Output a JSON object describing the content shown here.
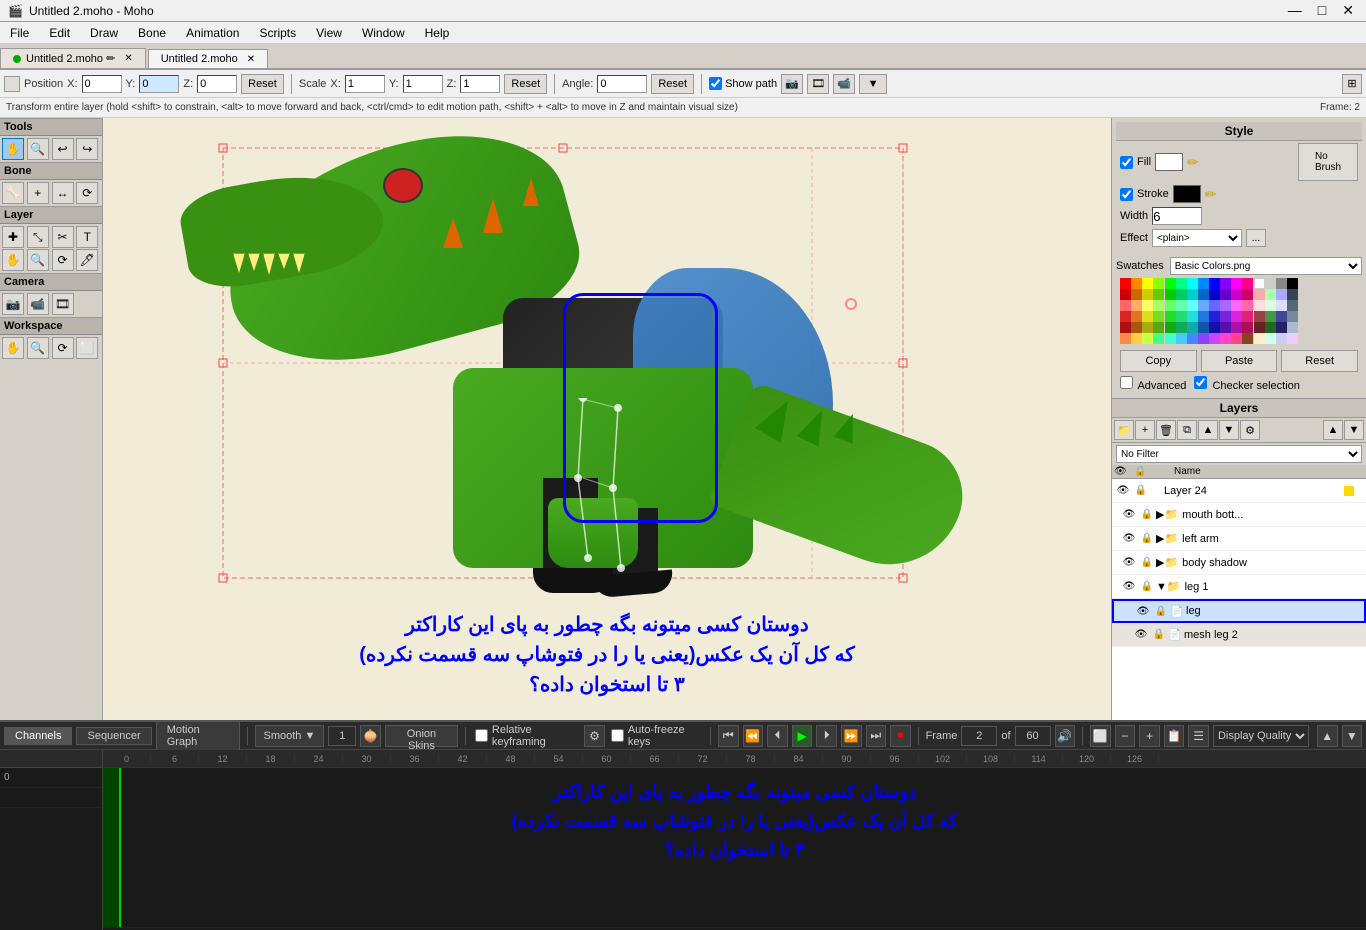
{
  "app": {
    "title": "Untitled 2.moho - Moho",
    "icon": "🎬"
  },
  "titlebar": {
    "title": "Untitled 2.moho - Moho",
    "minimize": "—",
    "maximize": "□",
    "close": "✕"
  },
  "menubar": {
    "items": [
      "File",
      "Edit",
      "Draw",
      "Bone",
      "Animation",
      "Scripts",
      "View",
      "Window",
      "Help"
    ]
  },
  "tabs": [
    {
      "label": "Untitled 2.moho",
      "active": false,
      "modified": true
    },
    {
      "label": "Untitled 2.moho",
      "active": true,
      "modified": false
    }
  ],
  "toolbar": {
    "position_label": "Position",
    "x_label": "X:",
    "x_val": "0",
    "y_label": "Y:",
    "y_val": "0",
    "z_label": "Z:",
    "z_val": "0",
    "reset1_label": "Reset",
    "scale_label": "Scale",
    "sx_label": "X:",
    "sx_val": "1",
    "sy_label": "Y:",
    "sy_val": "1",
    "sz_label": "Z:",
    "sz_val": "1",
    "reset2_label": "Reset",
    "angle_label": "Angle:",
    "angle_val": "0",
    "reset3_label": "Reset",
    "show_path_label": "Show path"
  },
  "infobar": {
    "text": "Transform entire layer (hold <shift> to constrain, <alt> to move forward and back, <ctrl/cmd> to edit motion path, <shift> + <alt> to move in Z and maintain visual size)",
    "frame": "Frame: 2"
  },
  "left_panel": {
    "tools_title": "Tools",
    "bone_title": "Bone",
    "layer_title": "Layer",
    "camera_title": "Camera",
    "workspace_title": "Workspace",
    "tools": [
      "✋",
      "🔍",
      "↩",
      "↪",
      "✚",
      "⤡",
      "⟳",
      "⬜",
      "⬛",
      "✂",
      "T",
      "🖊",
      "✋",
      "🔍",
      "⟳",
      "⬜",
      "📷",
      "📹",
      "🎞",
      "✋",
      "🔍",
      "⟳",
      "⬜"
    ]
  },
  "style_panel": {
    "title": "Style",
    "fill_label": "Fill",
    "stroke_label": "Stroke",
    "width_label": "Width",
    "width_val": "6",
    "effect_label": "Effect",
    "effect_val": "<plain>",
    "no_brush_label": "No\nBrush"
  },
  "swatches_panel": {
    "label": "Swatches",
    "preset_label": "Basic Colors.png",
    "copy_label": "Copy",
    "paste_label": "Paste",
    "reset_label": "Reset",
    "advanced_label": "Advanced",
    "checker_label": "Checker selection"
  },
  "layers_panel": {
    "title": "Layers",
    "filter_label": "No Filter",
    "name_col": "Name",
    "layers": [
      {
        "id": 1,
        "name": "Layer 24",
        "type": "layer",
        "indent": 0,
        "visible": true,
        "locked": false
      },
      {
        "id": 2,
        "name": "mouth bott...",
        "type": "folder",
        "indent": 1,
        "visible": true,
        "locked": false
      },
      {
        "id": 3,
        "name": "left arm",
        "type": "folder",
        "indent": 1,
        "visible": true,
        "locked": false
      },
      {
        "id": 4,
        "name": "body shadow",
        "type": "folder",
        "indent": 1,
        "visible": true,
        "locked": false
      },
      {
        "id": 5,
        "name": "leg 1",
        "type": "folder",
        "indent": 1,
        "visible": true,
        "locked": false,
        "expanded": true
      },
      {
        "id": 6,
        "name": "leg",
        "type": "layer",
        "indent": 2,
        "visible": true,
        "locked": false,
        "selected": true
      },
      {
        "id": 7,
        "name": "mesh leg 2",
        "type": "layer",
        "indent": 2,
        "visible": true,
        "locked": false
      }
    ]
  },
  "timeline": {
    "tabs": [
      "Channels",
      "Sequencer",
      "Motion Graph"
    ],
    "active_tab": "Channels",
    "smooth_label": "Smooth",
    "onion_label": "Onion Skins",
    "number_val": "1",
    "relative_keyframe_label": "Relative keyframing",
    "auto_freeze_label": "Auto-freeze keys",
    "frame_label": "Frame",
    "frame_val": "2",
    "of_label": "of",
    "total_frames": "60",
    "quality_label": "Display Quality",
    "ruler_marks": [
      "0",
      "6",
      "12",
      "18",
      "24",
      "30",
      "36",
      "42",
      "48",
      "54",
      "60",
      "66",
      "72",
      "78",
      "84",
      "90",
      "96",
      "102",
      "108",
      "114",
      "120",
      "126"
    ],
    "playback_btns": [
      "⏮",
      "⏪",
      "⏴",
      "▶",
      "⏵",
      "⏩",
      "⏭",
      "⏺"
    ]
  },
  "canvas": {
    "persian_text_1": "دوستان کسی میتونه بگه چطور به پای این کاراکتر",
    "persian_text_2": "که کل آن یک عکس(یعنی یا را در فتوشاپ سه قسمت نکرده)",
    "persian_text_3": "۳ تا استخوان داده؟"
  },
  "colors": {
    "accent_blue": "#0078d7",
    "selection_blue": "#0000ff",
    "timeline_bg": "#1a1a1a",
    "toolbar_bg": "#f0f0f0",
    "panel_bg": "#d4d0c8"
  }
}
